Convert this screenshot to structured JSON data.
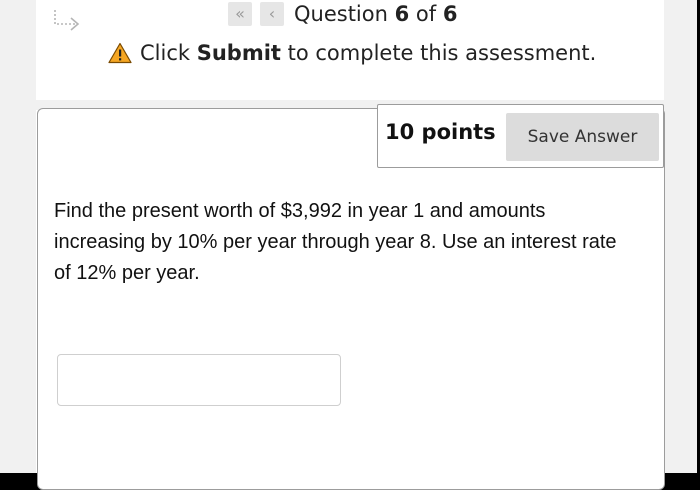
{
  "navigation": {
    "first_icon": "double-chevron-left-icon",
    "prev_icon": "chevron-left-icon",
    "question_prefix": "Question ",
    "question_current": "6",
    "question_of": " of ",
    "question_total": "6"
  },
  "notice": {
    "icon": "warning-icon",
    "prefix": "Click ",
    "emphasis": "Submit",
    "suffix": " to complete this assessment."
  },
  "question": {
    "points": "10 points",
    "save_label": "Save Answer",
    "text": "Find the present worth of $3,992 in year 1 and amounts increasing by 10% per year through year 8. Use an interest rate of 12% per year.",
    "answer_value": ""
  },
  "colors": {
    "warning_fill": "#f5a623",
    "button_gray": "#dcdcdc",
    "border_gray": "#9c9c9c"
  }
}
